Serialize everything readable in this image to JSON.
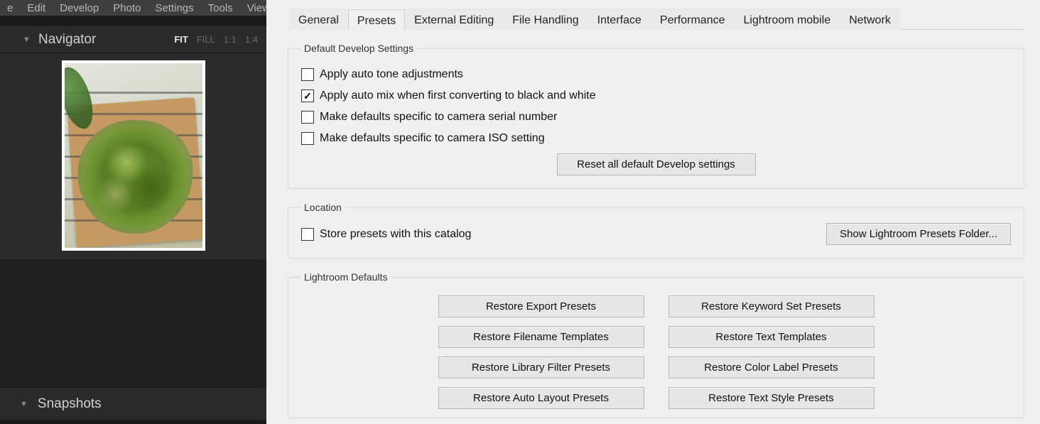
{
  "menu": {
    "items": [
      "e",
      "Edit",
      "Develop",
      "Photo",
      "Settings",
      "Tools",
      "View"
    ]
  },
  "navigator": {
    "title": "Navigator",
    "zoom": {
      "fit": "FIT",
      "fill": "FILL",
      "one": "1:1",
      "quarter": "1:4"
    }
  },
  "snapshots": {
    "title": "Snapshots"
  },
  "tabs": [
    "General",
    "Presets",
    "External Editing",
    "File Handling",
    "Interface",
    "Performance",
    "Lightroom mobile",
    "Network"
  ],
  "active_tab": "Presets",
  "group_defaults": {
    "legend": "Default Develop Settings",
    "opts": [
      {
        "label": "Apply auto tone adjustments",
        "checked": false
      },
      {
        "label": "Apply auto mix when first converting to black and white",
        "checked": true
      },
      {
        "label": "Make defaults specific to camera serial number",
        "checked": false
      },
      {
        "label": "Make defaults specific to camera ISO setting",
        "checked": false
      }
    ],
    "reset_btn": "Reset all default Develop settings"
  },
  "group_location": {
    "legend": "Location",
    "store_label": "Store presets with this catalog",
    "store_checked": false,
    "show_btn": "Show Lightroom Presets Folder..."
  },
  "group_lrdefaults": {
    "legend": "Lightroom Defaults",
    "buttons_left": [
      "Restore Export Presets",
      "Restore Filename Templates",
      "Restore Library Filter Presets",
      "Restore Auto Layout Presets"
    ],
    "buttons_right": [
      "Restore Keyword Set Presets",
      "Restore Text Templates",
      "Restore Color Label Presets",
      "Restore Text Style Presets"
    ]
  }
}
